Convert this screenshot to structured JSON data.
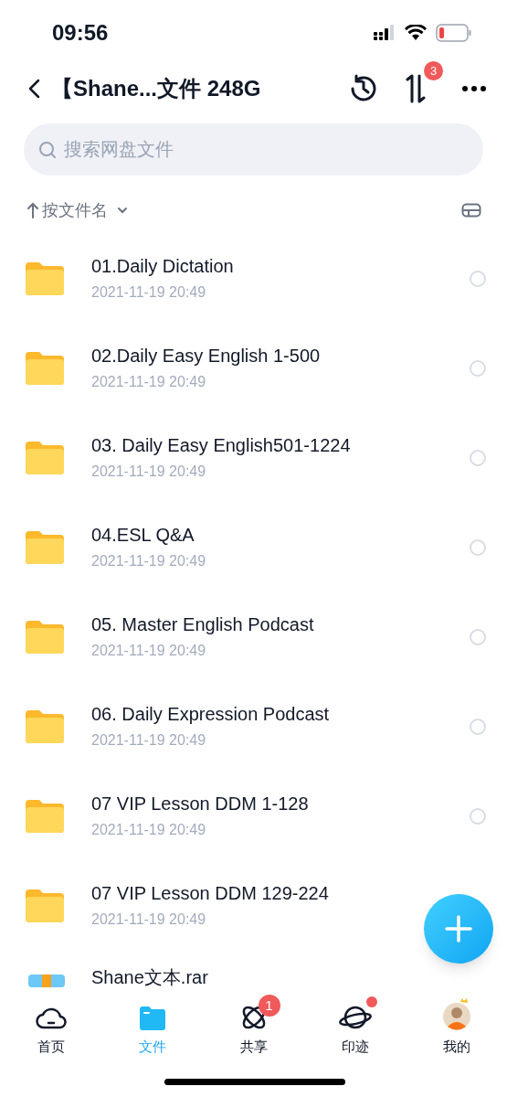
{
  "status_bar": {
    "time": "09:56"
  },
  "header": {
    "title": "【Shane...文件 248G",
    "transfer_badge": "3"
  },
  "search": {
    "placeholder": "搜索网盘文件"
  },
  "sort": {
    "label": "按文件名"
  },
  "files": [
    {
      "kind": "folder",
      "name": "01.Daily Dictation",
      "date": "2021-11-19 20:49",
      "selected": false
    },
    {
      "kind": "folder",
      "name": "02.Daily Easy English 1-500",
      "date": "2021-11-19 20:49",
      "selected": false
    },
    {
      "kind": "folder",
      "name": "03. Daily Easy English501-1224",
      "date": "2021-11-19 20:49",
      "selected": false
    },
    {
      "kind": "folder",
      "name": "04.ESL Q&A",
      "date": "2021-11-19 20:49",
      "selected": false
    },
    {
      "kind": "folder",
      "name": "05. Master English Podcast",
      "date": "2021-11-19 20:49",
      "selected": false
    },
    {
      "kind": "folder",
      "name": "06. Daily Expression Podcast",
      "date": "2021-11-19 20:49",
      "selected": false
    },
    {
      "kind": "folder",
      "name": "07 VIP Lesson DDM 1-128",
      "date": "2021-11-19 20:49",
      "selected": false
    },
    {
      "kind": "folder",
      "name": "07 VIP Lesson DDM 129-224",
      "date": "2021-11-19 20:49"
    },
    {
      "kind": "archive",
      "name": "Shane文本.rar"
    }
  ],
  "tabs": [
    {
      "kind": "home",
      "label": "首页",
      "selected": false
    },
    {
      "kind": "files",
      "label": "文件",
      "selected": true
    },
    {
      "kind": "share",
      "label": "共享",
      "selected": false,
      "badge": "1"
    },
    {
      "kind": "trace",
      "label": "印迹",
      "selected": false,
      "dot": true
    },
    {
      "kind": "me",
      "label": "我的",
      "selected": false
    }
  ]
}
